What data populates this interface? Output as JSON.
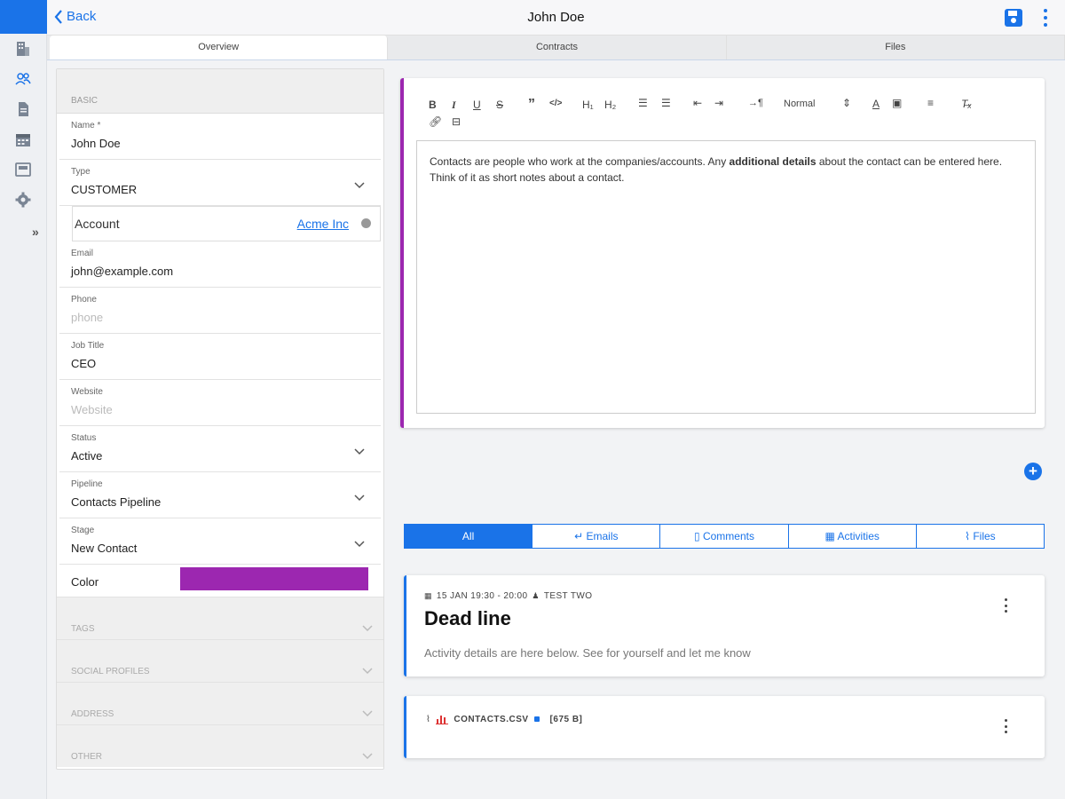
{
  "header": {
    "back_label": "Back",
    "title": "John Doe"
  },
  "tabs": [
    {
      "label": "Overview"
    },
    {
      "label": "Contracts"
    },
    {
      "label": "Files"
    }
  ],
  "form": {
    "section_basic": "BASIC",
    "name": {
      "label": "Name *",
      "value": "John Doe"
    },
    "type": {
      "label": "Type",
      "value": "CUSTOMER"
    },
    "account": {
      "label": "Account",
      "link": "Acme Inc"
    },
    "email": {
      "label": "Email",
      "value": "john@example.com"
    },
    "phone": {
      "label": "Phone",
      "placeholder": "phone"
    },
    "job_title": {
      "label": "Job Title",
      "value": "CEO"
    },
    "website": {
      "label": "Website",
      "placeholder": "Website"
    },
    "status": {
      "label": "Status",
      "value": "Active"
    },
    "pipeline": {
      "label": "Pipeline",
      "value": "Contacts Pipeline"
    },
    "stage": {
      "label": "Stage",
      "value": "New Contact"
    },
    "color": {
      "label": "Color",
      "value": "#9c27b0"
    },
    "collapsed_sections": [
      "TAGS",
      "SOCIAL PROFILES",
      "ADDRESS",
      "OTHER"
    ]
  },
  "editor": {
    "format_select": "Normal",
    "text_before": "Contacts are people who work at the companies/accounts. Any ",
    "text_bold": "additional details",
    "text_after": " about the contact can be entered here. Think of it as short notes about a contact.",
    "accent_color": "#9c27b0"
  },
  "filters": [
    {
      "label": "All",
      "icon": ""
    },
    {
      "label": "Emails",
      "icon": "reply-icon"
    },
    {
      "label": "Comments",
      "icon": "document-icon"
    },
    {
      "label": "Activities",
      "icon": "calendar-icon"
    },
    {
      "label": "Files",
      "icon": "paperclip-icon"
    }
  ],
  "activity": {
    "meta": "15 JAN 19:30 - 20:00",
    "user": "TEST TWO",
    "title": "Dead line",
    "body": "Activity details are here below. See for yourself and let me know"
  },
  "file": {
    "name": "CONTACTS.CSV",
    "size": "[675 B]"
  },
  "colors": {
    "accent": "#1a73e8",
    "purple": "#9c27b0"
  }
}
